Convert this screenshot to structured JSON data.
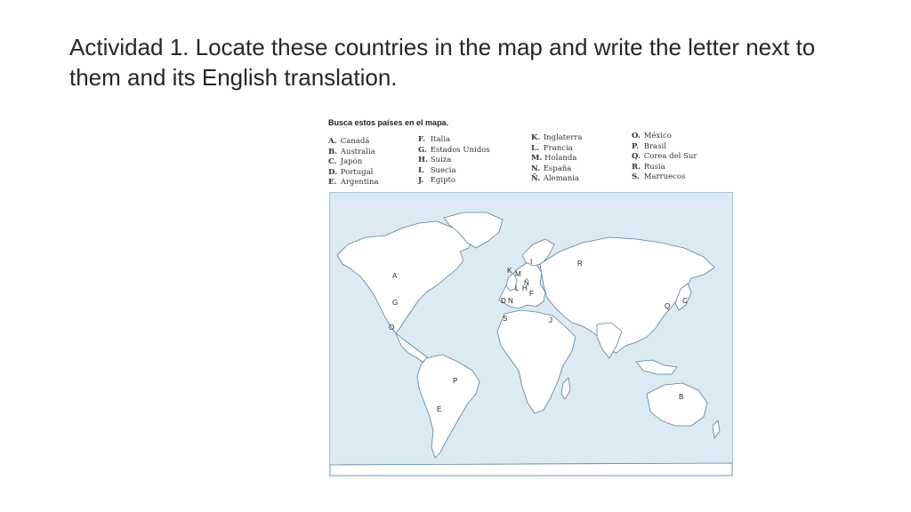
{
  "title": "Actividad 1. Locate these countries in the map and write the letter next to them and its English translation.",
  "worksheet": {
    "heading": "Busca estos países en el mapa.",
    "columns": [
      [
        {
          "letter": "A.",
          "name": "Canadá"
        },
        {
          "letter": "B.",
          "name": "Australia"
        },
        {
          "letter": "C.",
          "name": "Japón"
        },
        {
          "letter": "D.",
          "name": "Portugal"
        },
        {
          "letter": "E.",
          "name": "Argentina"
        }
      ],
      [
        {
          "letter": "F.",
          "name": "Italia"
        },
        {
          "letter": "G.",
          "name": "Estados Unidos"
        },
        {
          "letter": "H.",
          "name": "Suiza"
        },
        {
          "letter": "I.",
          "name": "Suecia"
        },
        {
          "letter": "J.",
          "name": "Egipto"
        }
      ],
      [
        {
          "letter": "K.",
          "name": "Inglaterra"
        },
        {
          "letter": "L.",
          "name": "Francia"
        },
        {
          "letter": "M.",
          "name": "Holanda"
        },
        {
          "letter": "N.",
          "name": "España"
        },
        {
          "letter": "Ñ.",
          "name": "Alemania"
        }
      ],
      [
        {
          "letter": "O.",
          "name": "México"
        },
        {
          "letter": "P.",
          "name": "Brasil"
        },
        {
          "letter": "Q.",
          "name": "Corea del Sur"
        },
        {
          "letter": "R.",
          "name": "Rusia"
        },
        {
          "letter": "S.",
          "name": "Marruecos"
        }
      ]
    ]
  },
  "map": {
    "ocean_color": "#dceaf3",
    "land_color": "#ffffff",
    "coast_color": "#5a7fa0",
    "labels": {
      "canada": "A",
      "usa": "G",
      "mexico": "O",
      "brazil": "P",
      "argentina": "E",
      "uk": "K",
      "netherlands": "M",
      "sweden": "I",
      "germany": "Ñ",
      "france": "L",
      "switzerland": "H",
      "italy": "F",
      "portugal": "D",
      "spain": "N",
      "morocco": "S",
      "egypt": "J",
      "russia": "R",
      "korea": "Q",
      "japan": "C",
      "australia": "B"
    }
  }
}
